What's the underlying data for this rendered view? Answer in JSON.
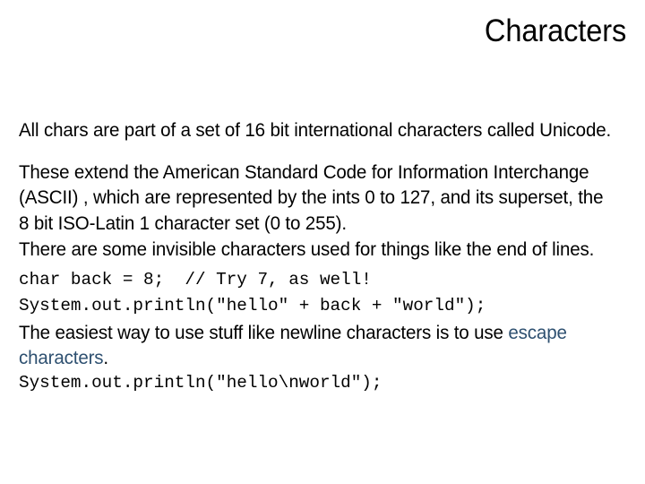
{
  "slide": {
    "title": "Characters",
    "background_color": "#FFFFFF",
    "text_color": "#000000",
    "accent_color": "#2E5070"
  },
  "content": {
    "paragraph_1": "All chars are part of a set of 16 bit international characters called Unicode.",
    "paragraph_2": "These extend the American Standard Code for Information Interchange (ASCII) , which are represented by the ints 0 to 127, and its superset, the 8 bit ISO-Latin 1 character set (0 to 255).",
    "paragraph_3": "There are some invisible characters used for things like the end of lines.",
    "code_1": "char back = 8;  // Try 7, as well!",
    "code_2": "System.out.println(\"hello\" + back + \"world\");",
    "paragraph_4_prefix": "The easiest way to use stuff like newline characters is to use ",
    "paragraph_4_link": "escape characters",
    "paragraph_4_suffix": ".",
    "code_3": "System.out.println(\"hello\\nworld\");"
  }
}
